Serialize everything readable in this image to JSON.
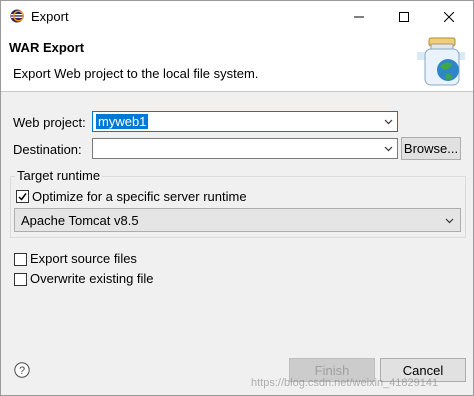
{
  "window": {
    "title": "Export",
    "controls": {
      "minimize": "minimize",
      "maximize": "maximize",
      "close": "close"
    }
  },
  "header": {
    "title": "WAR Export",
    "description": "Export Web project to the local file system."
  },
  "form": {
    "web_project_label": "Web project:",
    "web_project_value": "myweb1",
    "destination_label": "Destination:",
    "destination_value": "",
    "browse_label": "Browse..."
  },
  "target_runtime": {
    "group_label": "Target runtime",
    "optimize_label": "Optimize for a specific server runtime",
    "optimize_checked": true,
    "runtime_value": "Apache Tomcat v8.5"
  },
  "options": {
    "export_source_label": "Export source files",
    "export_source_checked": false,
    "overwrite_label": "Overwrite existing file",
    "overwrite_checked": false
  },
  "footer": {
    "help_icon": "question-mark",
    "finish_label": "Finish",
    "cancel_label": "Cancel",
    "watermark": "https://blog.csdn.net/weixin_41829141"
  }
}
